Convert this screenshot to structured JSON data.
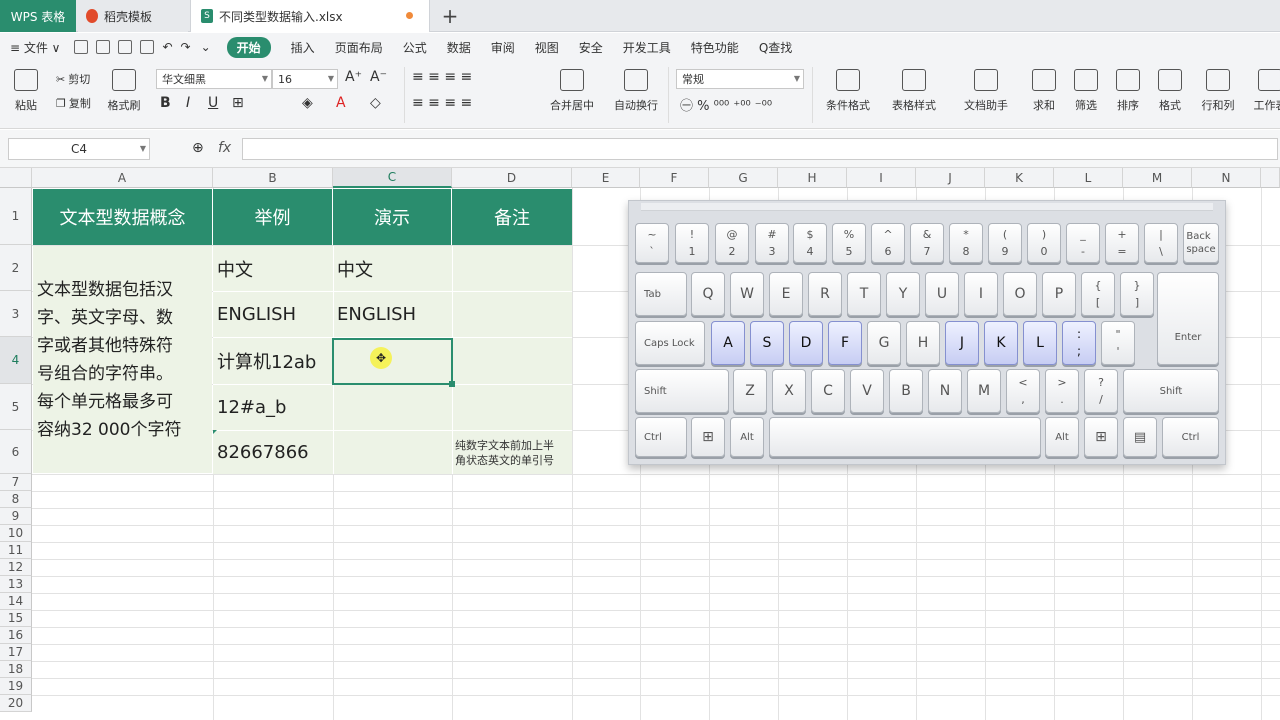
{
  "titlebar": {
    "app_tab": "WPS 表格",
    "template_tab": "稻壳模板",
    "file_tab": "不同类型数据输入.xlsx",
    "plus": "+"
  },
  "menubar": {
    "file": "≡ 文件 ∨",
    "items": [
      "开始",
      "插入",
      "页面布局",
      "公式",
      "数据",
      "审阅",
      "视图",
      "安全",
      "开发工具",
      "特色功能"
    ],
    "search": "Q查找"
  },
  "ribbon": {
    "paste": "粘贴",
    "cut": "剪切",
    "copy": "复制",
    "format_painter": "格式刷",
    "font_name": "华文细黑",
    "font_size": "16",
    "merge_center": "合并居中",
    "wrap_text": "自动换行",
    "number_format": "常规",
    "cond_format": "条件格式",
    "table_style": "表格样式",
    "doc_helper": "文档助手",
    "sum": "求和",
    "filter": "筛选",
    "sort": "排序",
    "format": "格式",
    "row_col": "行和列",
    "worksheet": "工作表"
  },
  "formulabar": {
    "cell_ref": "C4",
    "fx": "fx",
    "value": ""
  },
  "sheet": {
    "columns": [
      "A",
      "B",
      "C",
      "D",
      "E",
      "F",
      "G",
      "H",
      "I",
      "J",
      "K",
      "L",
      "M",
      "N"
    ],
    "rows": [
      "1",
      "2",
      "3",
      "4",
      "5",
      "6",
      "7",
      "8",
      "9",
      "10",
      "11",
      "12",
      "13",
      "14",
      "15",
      "16",
      "17",
      "18",
      "19",
      "20"
    ],
    "header": [
      "文本型数据概念",
      "举例",
      "演示",
      "备注"
    ],
    "concept": "文本型数据包括汉\n字、英文字母、数\n字或者其他特殊符\n号组合的字符串。\n每个单元格最多可\n容纳32 000个字符",
    "examples": [
      "中文",
      "ENGLISH",
      "计算机12ab",
      "12#a_b",
      "82667866"
    ],
    "demo": [
      "中文",
      "ENGLISH"
    ],
    "note": "纯数字文本前加上半\n角状态英文的单引号",
    "active_cell": "C4"
  },
  "keyboard": {
    "row1": [
      [
        "~",
        "`"
      ],
      [
        "!",
        "1"
      ],
      [
        "@",
        "2"
      ],
      [
        "#",
        "3"
      ],
      [
        "$",
        "4"
      ],
      [
        "%",
        "5"
      ],
      [
        "^",
        "6"
      ],
      [
        "&",
        "7"
      ],
      [
        "*",
        "8"
      ],
      [
        "(",
        "9"
      ],
      [
        ")",
        "0"
      ],
      [
        "_",
        "-"
      ],
      [
        "+",
        "="
      ],
      [
        "|",
        "\\"
      ]
    ],
    "backspace": "Back\nspace",
    "tab": "Tab",
    "row2": [
      "Q",
      "W",
      "E",
      "R",
      "T",
      "Y",
      "U",
      "I",
      "O",
      "P"
    ],
    "row2b": [
      [
        "{",
        "["
      ],
      [
        "}",
        "]"
      ]
    ],
    "caps": "Caps Lock",
    "row3": [
      "A",
      "S",
      "D",
      "F",
      "G",
      "H",
      "J",
      "K",
      "L"
    ],
    "row3b": [
      [
        ":",
        ";"
      ],
      [
        "\"",
        "'"
      ]
    ],
    "enter": "Enter",
    "shift": "Shift",
    "row4": [
      "Z",
      "X",
      "C",
      "V",
      "B",
      "N",
      "M"
    ],
    "row4b": [
      [
        "<",
        ","
      ],
      [
        ">",
        "."
      ],
      [
        "?",
        "/"
      ]
    ],
    "ctrl": "Ctrl",
    "alt": "Alt"
  }
}
